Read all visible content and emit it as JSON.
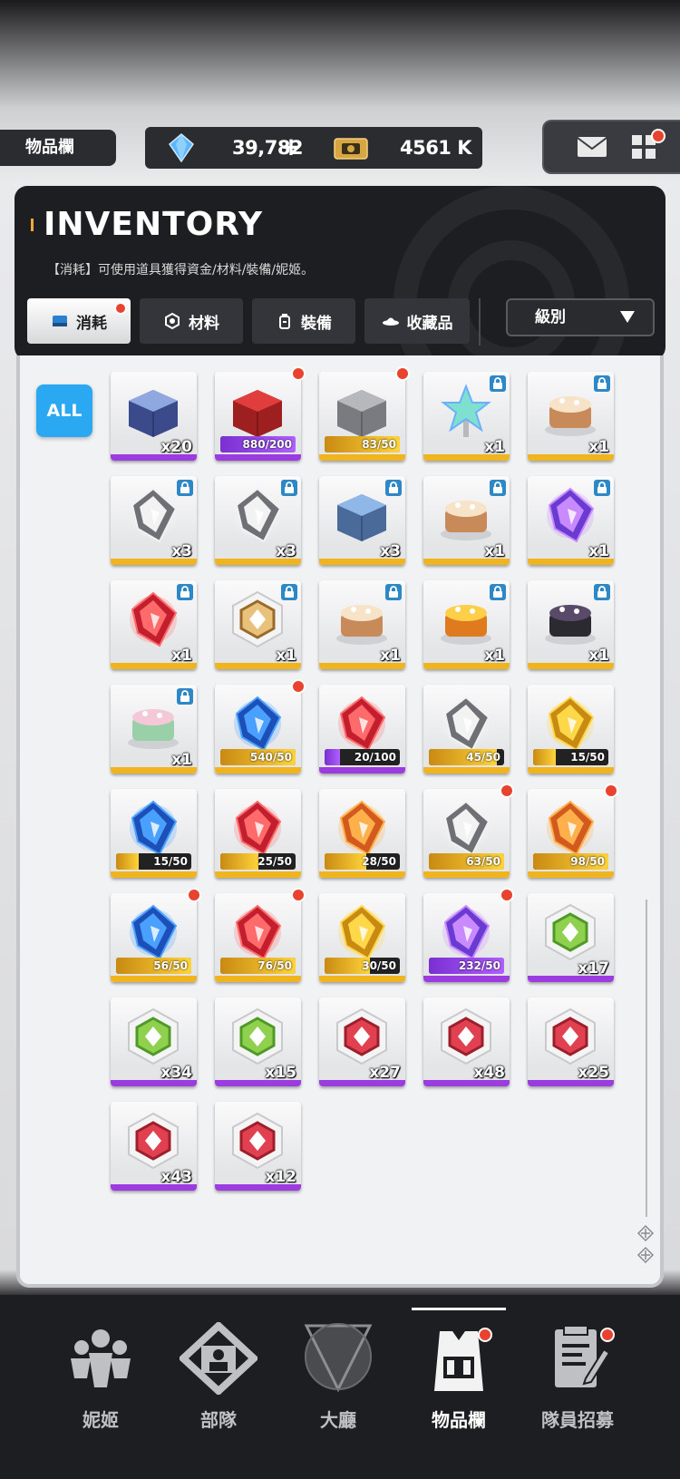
{
  "header": {
    "title": "物品欄",
    "gems": "39,782",
    "gem_plus": "+",
    "credits": "4561 K"
  },
  "inventory": {
    "title": "INVENTORY",
    "description": "【消耗】可使用道具獲得資金/材料/裝備/妮姬。",
    "tabs": [
      {
        "label": "消耗",
        "active": true,
        "icon": "consumable-icon"
      },
      {
        "label": "材料",
        "active": false,
        "icon": "material-icon"
      },
      {
        "label": "裝備",
        "active": false,
        "icon": "equipment-icon"
      },
      {
        "label": "收藏品",
        "active": false,
        "icon": "collection-icon"
      }
    ],
    "sort_label": "級別",
    "filter_all": "ALL"
  },
  "items": [
    {
      "name": "gift-box",
      "qty": "x20",
      "rarity": "purple"
    },
    {
      "name": "lucky-box",
      "progress": "880/200",
      "fill": 1.0,
      "rarity": "purple",
      "dot": true
    },
    {
      "name": "equipment-box",
      "progress": "83/50",
      "fill": 1.0,
      "rarity": "gold",
      "dot": true
    },
    {
      "name": "gift-star-flower",
      "qty": "x1",
      "rarity": "gold",
      "lock": true
    },
    {
      "name": "gift-35-cake",
      "qty": "x1",
      "rarity": "gold",
      "lock": true
    },
    {
      "name": "gift-silver-briefs",
      "qty": "x3",
      "rarity": "gold",
      "lock": true
    },
    {
      "name": "gift-silver-bra",
      "qty": "x3",
      "rarity": "gold",
      "lock": true
    },
    {
      "name": "gift-robot-head",
      "qty": "x3",
      "rarity": "gold",
      "lock": true
    },
    {
      "name": "gift-1000-cake",
      "qty": "x1",
      "rarity": "gold",
      "lock": true
    },
    {
      "name": "gift-purple-cake",
      "qty": "x1",
      "rarity": "gold",
      "lock": true
    },
    {
      "name": "gift-red-cake",
      "qty": "x1",
      "rarity": "gold",
      "lock": true
    },
    {
      "name": "gift-medal",
      "qty": "x1",
      "rarity": "gold",
      "lock": true
    },
    {
      "name": "gift-15-cake",
      "qty": "x1",
      "rarity": "gold",
      "lock": true
    },
    {
      "name": "gift-omelette",
      "qty": "x1",
      "rarity": "gold",
      "lock": true
    },
    {
      "name": "gift-stew-pot",
      "qty": "x1",
      "rarity": "gold",
      "lock": true
    },
    {
      "name": "gift-keychain",
      "qty": "x1",
      "rarity": "gold",
      "lock": true
    },
    {
      "name": "design-blueprint",
      "progress": "540/50",
      "fill": 1.0,
      "rarity": "gold",
      "dot": true
    },
    {
      "name": "red-backpack",
      "progress": "20/100",
      "fill": 0.2,
      "rarity": "purple"
    },
    {
      "name": "ssr-core-silver-a",
      "progress": "45/50",
      "fill": 0.9,
      "rarity": "gold"
    },
    {
      "name": "ssr-core-gold-t",
      "progress": "15/50",
      "fill": 0.3,
      "rarity": "gold"
    },
    {
      "name": "ssr-core-blue-m",
      "progress": "15/50",
      "fill": 0.3,
      "rarity": "gold"
    },
    {
      "name": "ssr-core-red-grid",
      "progress": "25/50",
      "fill": 0.5,
      "rarity": "gold"
    },
    {
      "name": "ssr-core-orange",
      "progress": "28/50",
      "fill": 0.56,
      "rarity": "gold"
    },
    {
      "name": "core-silver-a",
      "progress": "63/50",
      "fill": 1.0,
      "rarity": "gold",
      "dot": true
    },
    {
      "name": "core-orange-t",
      "progress": "98/50",
      "fill": 1.0,
      "rarity": "gold",
      "dot": true
    },
    {
      "name": "core-blue-m",
      "progress": "56/50",
      "fill": 1.0,
      "rarity": "gold",
      "dot": true
    },
    {
      "name": "core-red-grid",
      "progress": "76/50",
      "fill": 1.0,
      "rarity": "gold",
      "dot": true
    },
    {
      "name": "core-gold",
      "progress": "30/50",
      "fill": 0.6,
      "rarity": "gold"
    },
    {
      "name": "core-purple",
      "progress": "232/50",
      "fill": 1.0,
      "rarity": "purple",
      "dot": true
    },
    {
      "name": "module-green-star",
      "qty": "x17",
      "rarity": "purple"
    },
    {
      "name": "module-green-shield",
      "qty": "x34",
      "rarity": "purple"
    },
    {
      "name": "module-green-arrow",
      "qty": "x15",
      "rarity": "purple"
    },
    {
      "name": "module-red-swirl",
      "qty": "x27",
      "rarity": "purple"
    },
    {
      "name": "module-red-a",
      "qty": "x48",
      "rarity": "purple"
    },
    {
      "name": "module-red-t",
      "qty": "x25",
      "rarity": "purple"
    },
    {
      "name": "module-red-m",
      "qty": "x43",
      "rarity": "purple"
    },
    {
      "name": "module-red-grid",
      "qty": "x12",
      "rarity": "purple"
    }
  ],
  "nav": [
    {
      "label": "妮姬",
      "icon": "nikke-icon",
      "active": false
    },
    {
      "label": "部隊",
      "icon": "squad-icon",
      "active": false
    },
    {
      "label": "大廳",
      "icon": "lobby-icon",
      "active": false
    },
    {
      "label": "物品欄",
      "icon": "inventory-icon",
      "active": true,
      "dot": true
    },
    {
      "label": "隊員招募",
      "icon": "recruit-icon",
      "active": false,
      "dot": true
    }
  ],
  "colors": {
    "rarity_purple": "#9b3be0",
    "rarity_gold": "#f0b41e",
    "accent_blue": "#2aa8f2",
    "dot_red": "#e8432e"
  }
}
